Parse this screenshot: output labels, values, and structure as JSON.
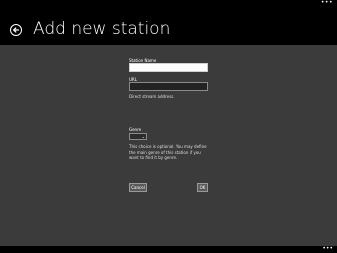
{
  "header": {
    "title": "Add new station",
    "more_glyph": "•••",
    "back_icon": "back-arrow-circle-icon"
  },
  "form": {
    "station_name_label": "Station Name",
    "station_name_value": "",
    "url_label": "URL",
    "url_value": "",
    "url_hint": "Direct stream address.",
    "genre_label": "Genre",
    "genre_selected": "",
    "genre_hint": "This choice is optional. You may define the main genre of this station if you want to find it by genre."
  },
  "actions": {
    "cancel_label": "Cancel",
    "ok_label": "OK"
  },
  "footer": {
    "more_glyph": "•••"
  },
  "colors": {
    "app_bar": "#000000",
    "content_background": "#3b3b3b",
    "text": "#ffffff"
  }
}
